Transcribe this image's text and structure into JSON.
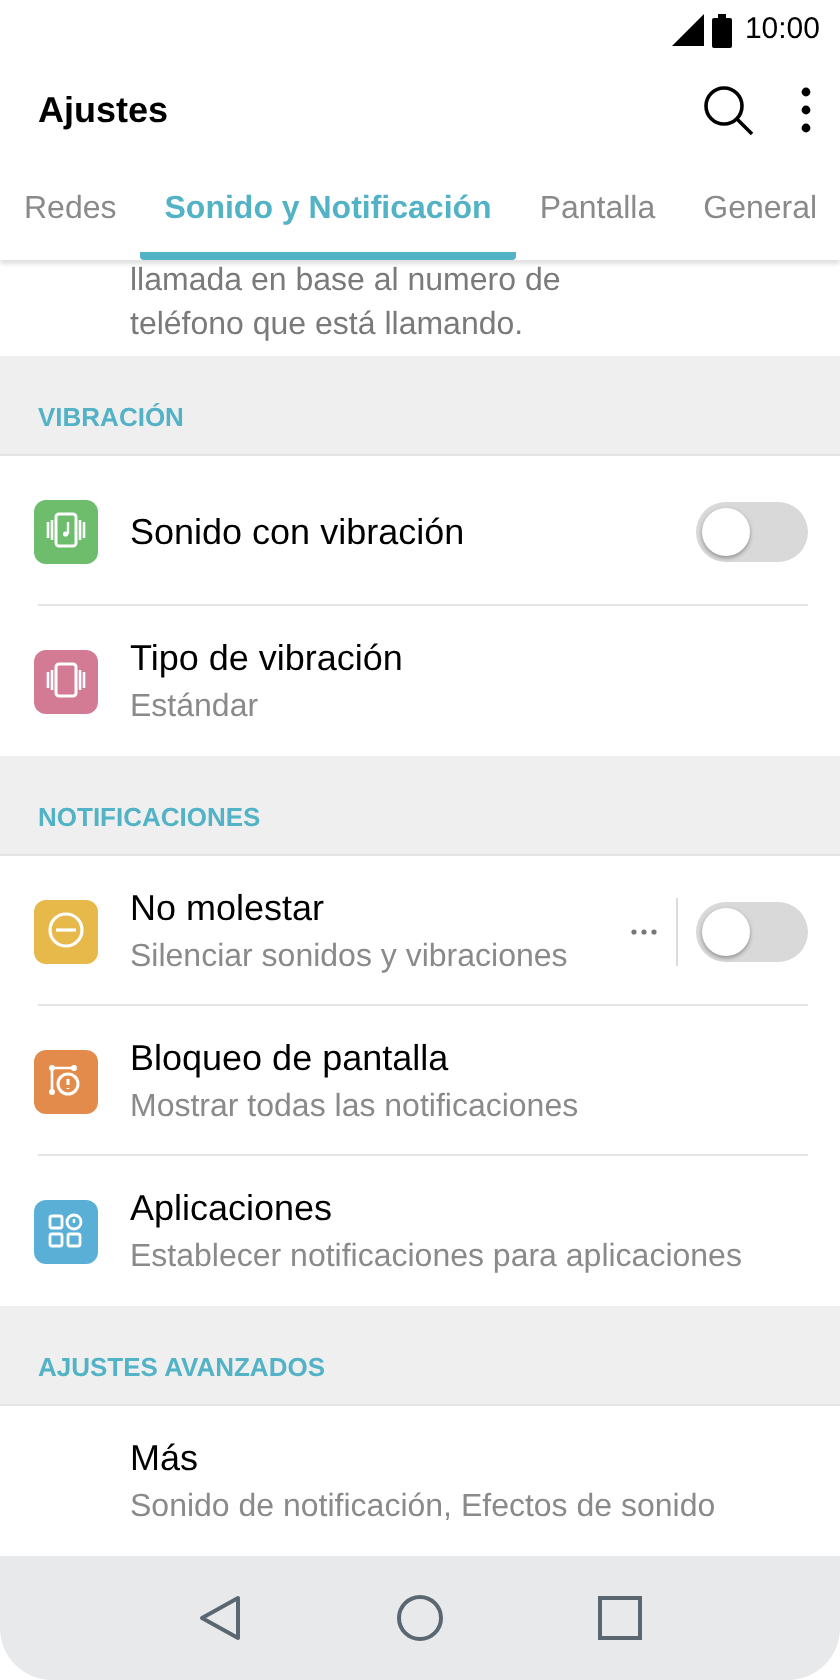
{
  "status_bar": {
    "time": "10:00"
  },
  "header": {
    "title": "Ajustes"
  },
  "tabs": [
    {
      "label": "Redes",
      "selected": false
    },
    {
      "label": "Sonido y Notificación",
      "selected": true
    },
    {
      "label": "Pantalla",
      "selected": false
    },
    {
      "label": "General",
      "selected": false
    }
  ],
  "partial_text": [
    "llamada en base al numero de",
    "teléfono que está llamando."
  ],
  "sections": [
    {
      "header": "VIBRACIÓN",
      "items": [
        {
          "title": "Sonido con vibración",
          "color": "#6dbd6c",
          "kind": "toggle",
          "on": false
        },
        {
          "title": "Tipo de vibración",
          "subtitle": "Estándar",
          "color": "#d37a94",
          "kind": "plain"
        }
      ]
    },
    {
      "header": "NOTIFICACIONES",
      "items": [
        {
          "title": "No molestar",
          "subtitle": "Silenciar sonidos y vibraciones",
          "color": "#e6b94a",
          "kind": "toggle_more",
          "on": false
        },
        {
          "title": "Bloqueo de pantalla",
          "subtitle": "Mostrar todas las notificaciones",
          "color": "#e38b4a",
          "kind": "plain"
        },
        {
          "title": "Aplicaciones",
          "subtitle": "Establecer notificaciones para aplicaciones",
          "color": "#5aafd6",
          "kind": "plain"
        }
      ]
    },
    {
      "header": "AJUSTES AVANZADOS",
      "items": [
        {
          "title": "Más",
          "subtitle": "Sonido de notificación, Efectos de sonido",
          "kind": "plain"
        }
      ]
    }
  ]
}
